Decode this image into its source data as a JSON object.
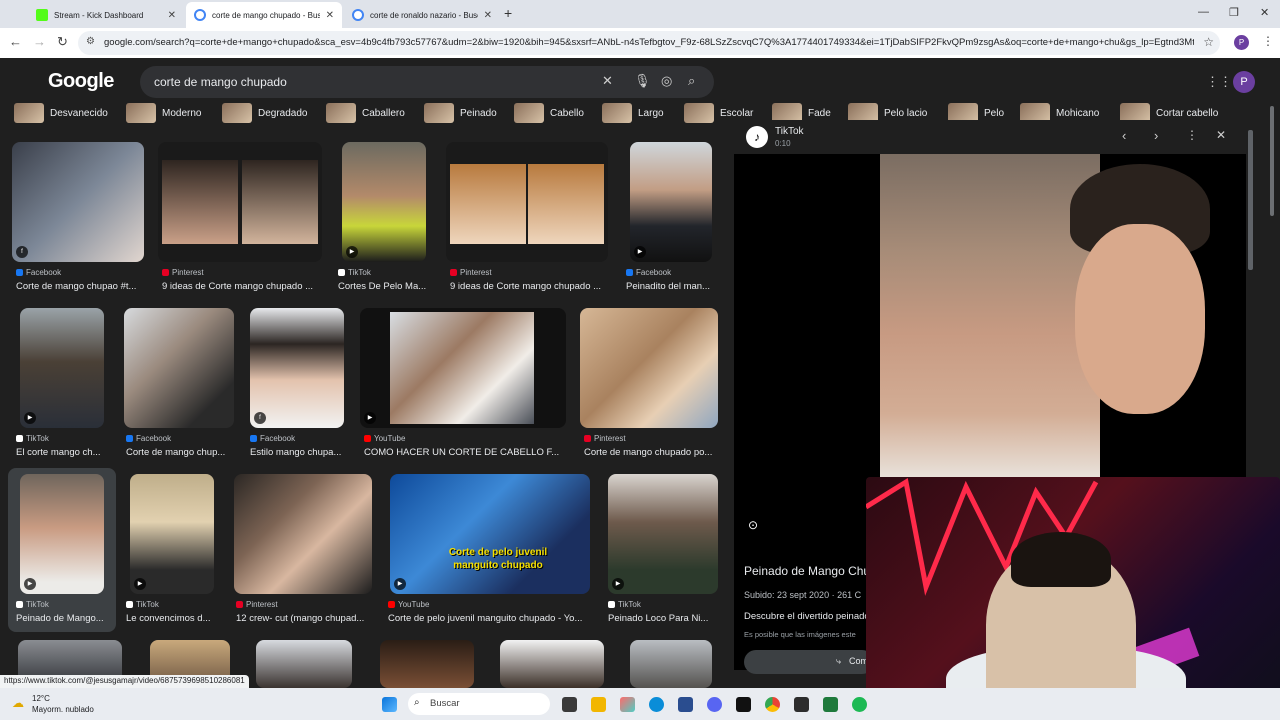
{
  "browser": {
    "tabs": [
      {
        "title": "Stream - Kick Dashboard",
        "color": "#53fc18",
        "active": false
      },
      {
        "title": "corte de mango chupado - Bus",
        "color": "#4285f4",
        "active": true
      },
      {
        "title": "corte de ronaldo nazario - Busc",
        "color": "#4285f4",
        "active": false
      }
    ],
    "new_tab": "+",
    "url": "google.com/search?q=corte+de+mango+chupado&sca_esv=4b9c4fb793c57767&udm=2&biw=1920&bih=945&sxsrf=ANbL-n4sTefbgtov_F9z-68LSzZscvqC7Q%3A1774401749334&ei=1TjDabSIFP2FkvQPm9zsgAs&oq=corte+de+mango+chu&gs_lp=Egtnd3Mtd2...",
    "profile_letter": "P"
  },
  "google": {
    "logo": "Google",
    "query": "corte de mango chupado",
    "avatar_letter": "P"
  },
  "chips": [
    "Desvanecido",
    "Moderno",
    "Degradado",
    "Caballero",
    "Peinado",
    "Cabello",
    "Largo",
    "Escolar",
    "Fade",
    "Pelo lacio",
    "Pelo",
    "Mohicano",
    "Cortar cabello"
  ],
  "results": [
    {
      "source": "Facebook",
      "caption": "Corte de mango chupao #t...",
      "src_color": "#1877f2"
    },
    {
      "source": "Pinterest",
      "caption": "9 ideas de Corte mango chupado ...",
      "src_color": "#e60023"
    },
    {
      "source": "TikTok",
      "caption": "Cortes De Pelo Ma...",
      "src_color": "#ffffff"
    },
    {
      "source": "Pinterest",
      "caption": "9 ideas de Corte mango chupado ...",
      "src_color": "#e60023"
    },
    {
      "source": "Facebook",
      "caption": "Peinadito del man...",
      "src_color": "#1877f2"
    },
    {
      "source": "TikTok",
      "caption": "El corte mango ch...",
      "src_color": "#ffffff"
    },
    {
      "source": "Facebook",
      "caption": "Corte de mango chup...",
      "src_color": "#1877f2"
    },
    {
      "source": "Facebook",
      "caption": "Estilo mango chupa...",
      "src_color": "#1877f2"
    },
    {
      "source": "YouTube",
      "caption": "COMO HACER UN CORTE DE CABELLO F...",
      "src_color": "#ff0000"
    },
    {
      "source": "Pinterest",
      "caption": "Corte de mango chupado po...",
      "src_color": "#e60023"
    },
    {
      "source": "TikTok",
      "caption": "Peinado de Mango...",
      "src_color": "#ffffff"
    },
    {
      "source": "TikTok",
      "caption": "Le convencimos d...",
      "src_color": "#ffffff"
    },
    {
      "source": "Pinterest",
      "caption": "12 crew- cut (mango chupad...",
      "src_color": "#e60023"
    },
    {
      "source": "YouTube",
      "caption": "Corte de pelo juvenil manguito chupado - Yo...",
      "src_color": "#ff0000"
    },
    {
      "source": "TikTok",
      "caption": "Peinado Loco Para Ni...",
      "src_color": "#ffffff"
    }
  ],
  "youtube_overlay_text": "Corte de pelo juvenil manguito chupado",
  "preview": {
    "source": "TikTok",
    "duration": "0:10",
    "title": "Peinado de Mango Chu",
    "uploaded": "Subido: 23 sept 2020 · 261 C",
    "description": "Descubre el divertido peinado",
    "disclaimer": "Es posible que las imágenes este",
    "share_label": "Com"
  },
  "status_url": "https://www.tiktok.com/@jesusgamajr/video/6875739698510286081",
  "taskbar": {
    "temperature": "12°C",
    "weather_desc": "Mayorm. nublado",
    "search_placeholder": "Buscar"
  }
}
